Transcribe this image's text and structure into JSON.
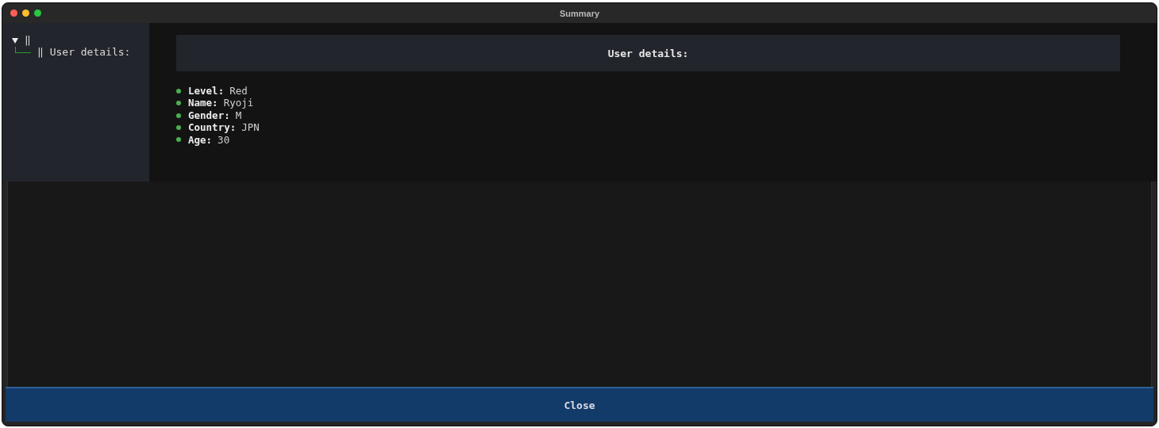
{
  "window": {
    "title": "Summary"
  },
  "tree": {
    "label": "‖",
    "expanded": true,
    "children": [
      {
        "label": "‖ User details:"
      }
    ]
  },
  "panel": {
    "heading": "User details:",
    "fields": [
      {
        "label": "Level:",
        "value": "Red"
      },
      {
        "label": "Name:",
        "value": "Ryoji"
      },
      {
        "label": "Gender:",
        "value": "M"
      },
      {
        "label": "Country:",
        "value": "JPN"
      },
      {
        "label": "Age:",
        "value": "30"
      }
    ]
  },
  "buttons": [
    "Close"
  ]
}
